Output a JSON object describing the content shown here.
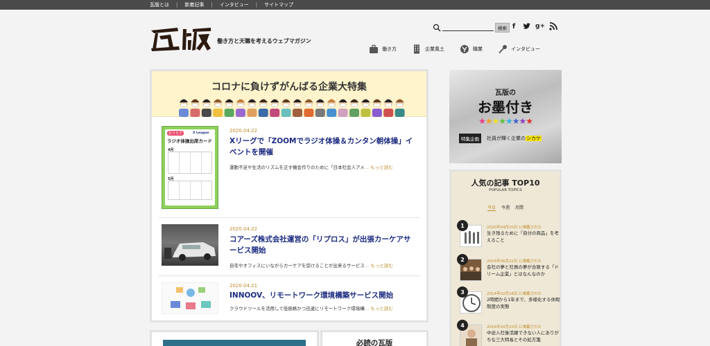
{
  "topnav": {
    "items": [
      "瓦版とは",
      "新着記事",
      "インタビュー",
      "サイトマップ"
    ],
    "separator": "|"
  },
  "header": {
    "logo_text": "瓦版",
    "tagline": "働き方と天職を考えるウェブマガジン",
    "search_placeholder": "",
    "search_button": "検索",
    "social": {
      "facebook": "f",
      "twitter": "t",
      "googleplus": "g+",
      "rss": "rss"
    },
    "categories": [
      {
        "label": "働き方",
        "icon": "bag-icon"
      },
      {
        "label": "企業風土",
        "icon": "building-icon"
      },
      {
        "label": "職業",
        "icon": "profession-icon"
      },
      {
        "label": "インタビュー",
        "icon": "microphone-icon"
      }
    ]
  },
  "feature": {
    "banner_title": "コロナに負けずがんばる企業大特集"
  },
  "articles": [
    {
      "date": "2020.04.22",
      "title": "Xリーグで「ZOOMでラジオ体操＆カンタン朝体操」イベントを開催",
      "excerpt": "運動不足や生活のリズムを正す機会作りのために「日本社会人アメ",
      "more": "… もっと読む",
      "thumb": {
        "logo": "X League",
        "card_title": "ラジオ体操出席カード",
        "label_top": "おうちで",
        "month1": "4月",
        "month2": "5月"
      }
    },
    {
      "date": "2020.04.22",
      "title": "コアーズ株式会社運営の「リプロス」が出張カーケアサービス開始",
      "excerpt": "自宅やオフィスにいながらカーケアを受けることが出来るサービス",
      "more": "… もっと読む"
    },
    {
      "date": "2020.04.21",
      "title": "INNOOV、リモートワーク環境構築サービス開始",
      "excerpt": "クラウドツールを活用して低価格かつ迅速にリモートワーク環境構",
      "more": "… もっと読む"
    }
  ],
  "bottom": {
    "must_read": "必読の瓦版"
  },
  "side_ad": {
    "line1": "瓦版の",
    "line2": "お墨付き",
    "stars": "★★★★★★★★",
    "badge": "特集企画",
    "sub_prefix": "社員が輝く企業の",
    "sub_highlight": "シカケ"
  },
  "popular": {
    "title": "人気の記事 TOP10",
    "subtitle": "POPULAR TOPICS",
    "tabs": [
      "今日",
      "今週",
      "月間"
    ],
    "items": [
      {
        "rank": "1",
        "date": "2020年04月20日 に掲載された",
        "text": "生き残るために「自分の商品」を考えること"
      },
      {
        "rank": "2",
        "date": "2016年06月22日 に掲載された",
        "text": "会社の夢と社員の夢が合致する「ドリーム企業」とはなんなのか"
      },
      {
        "rank": "3",
        "date": "2014年02月18日 に掲載された",
        "text": "2時間から1年まで、多様化する休暇制度の実態"
      },
      {
        "rank": "4",
        "date": "2016年10月20日 に掲載された",
        "text": "中途入社後活躍できない人にありがちな三大特長とその処方箋"
      }
    ]
  }
}
